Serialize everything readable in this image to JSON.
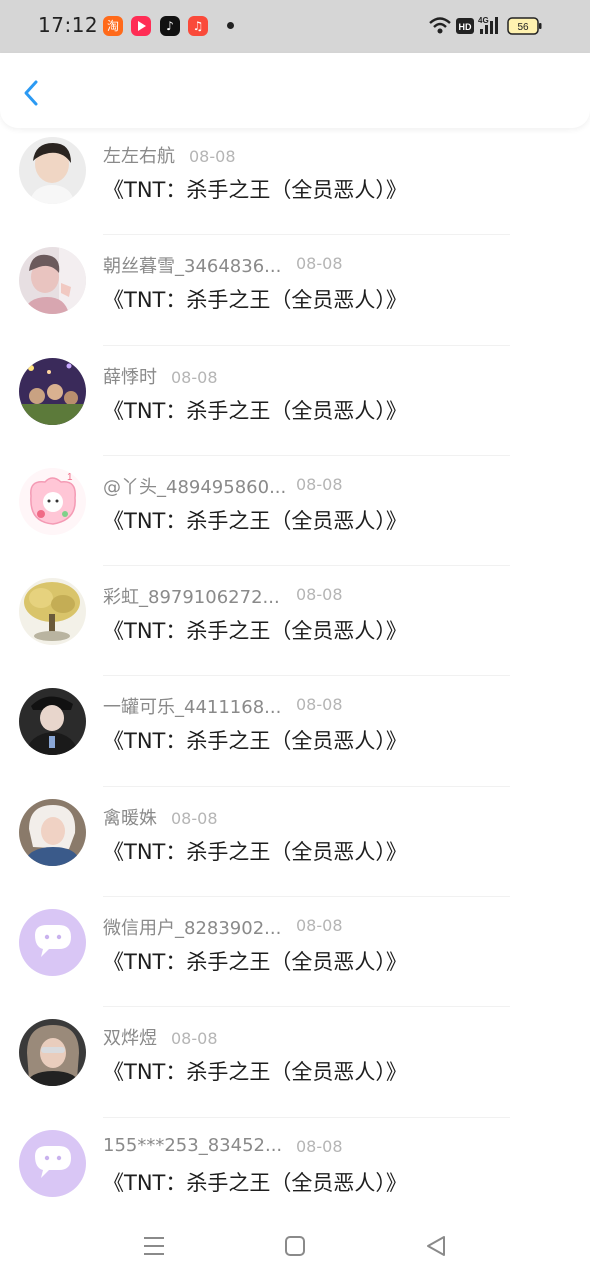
{
  "status_bar": {
    "time": "17:12",
    "network": "4G",
    "hd": "HD",
    "battery": "56",
    "app_icons": [
      "taobao-icon",
      "video-app-icon",
      "tiktok-icon",
      "music-app-icon"
    ]
  },
  "header": {
    "back_icon": "chevron-left-icon",
    "accent": "#2b9af3"
  },
  "items": [
    {
      "name": "左左右航",
      "date": "08-08",
      "message": "《TNT：杀手之王（全员恶人）》"
    },
    {
      "name": "朝丝暮雪_3464836...",
      "date": "08-08",
      "message": "《TNT：杀手之王（全员恶人）》"
    },
    {
      "name": "薛悸时",
      "date": "08-08",
      "message": "《TNT：杀手之王（全员恶人）》"
    },
    {
      "name": "@丫头_489495860...",
      "date": "08-08",
      "message": "《TNT：杀手之王（全员恶人）》"
    },
    {
      "name": "彩虹_8979106272...",
      "date": "08-08",
      "message": "《TNT：杀手之王（全员恶人）》"
    },
    {
      "name": "一罐可乐_4411168...",
      "date": "08-08",
      "message": "《TNT：杀手之王（全员恶人）》"
    },
    {
      "name": "禽暖姝",
      "date": "08-08",
      "message": "《TNT：杀手之王（全员恶人）》"
    },
    {
      "name": "微信用户_8283902...",
      "date": "08-08",
      "message": "《TNT：杀手之王（全员恶人）》"
    },
    {
      "name": "双烨煜",
      "date": "08-08",
      "message": "《TNT：杀手之王（全员恶人）》"
    },
    {
      "name": "155***253_83452...",
      "date": "08-08",
      "message": "《TNT：杀手之王（全员恶人）》"
    }
  ],
  "nav": [
    "menu-icon",
    "home-square-icon",
    "back-triangle-icon"
  ]
}
